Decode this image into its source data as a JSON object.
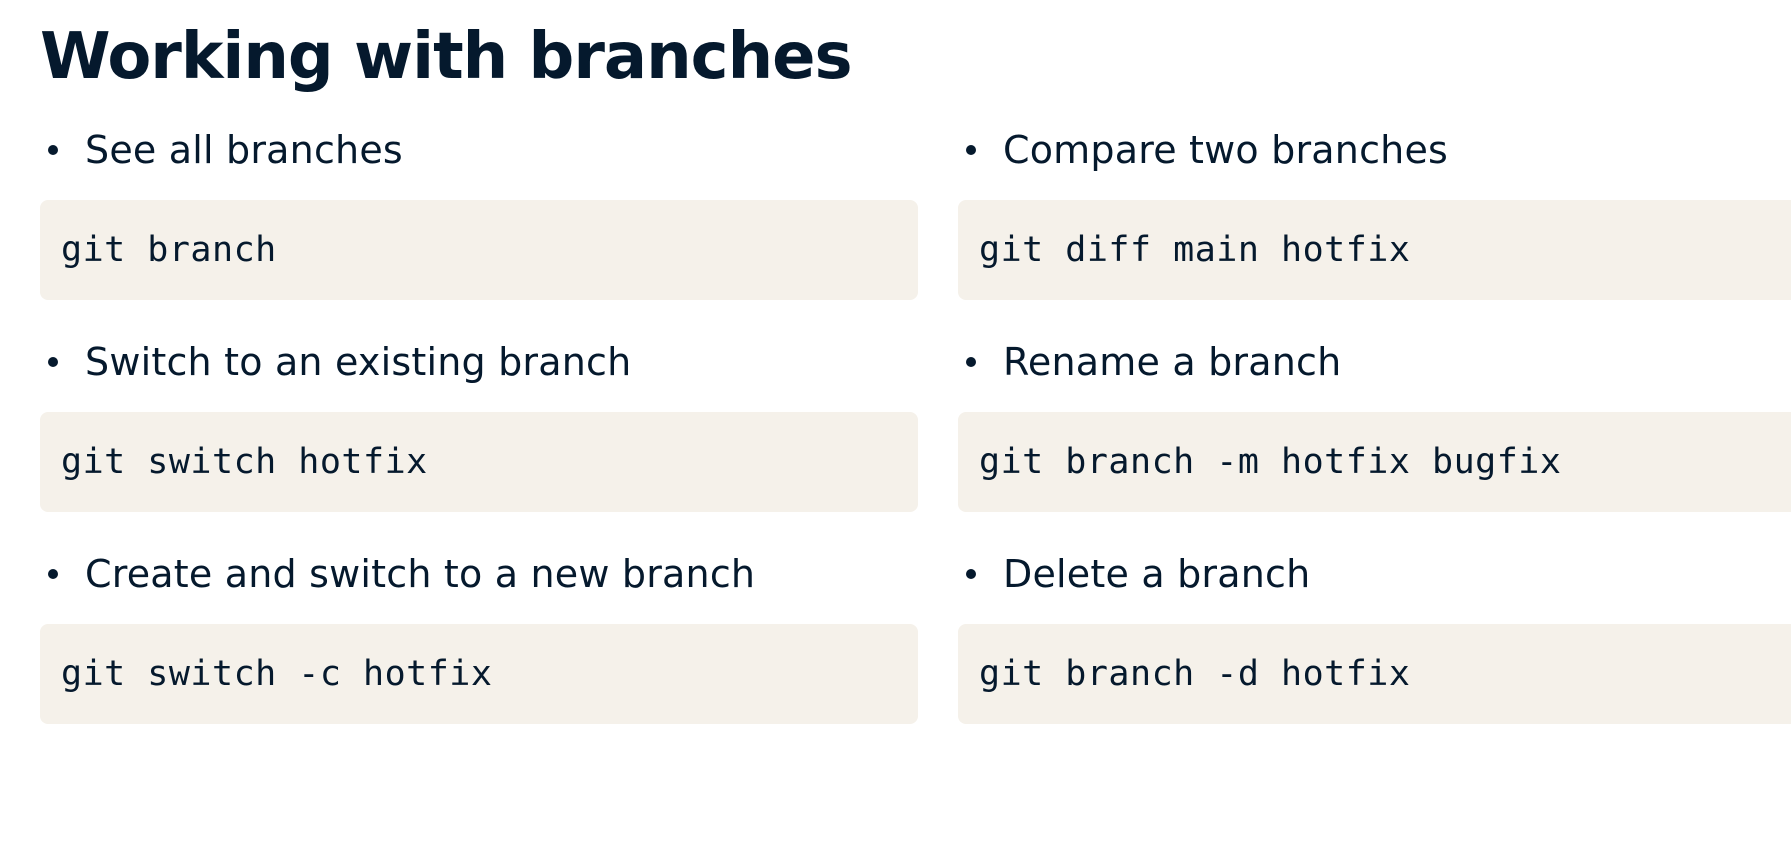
{
  "title": "Working with branches",
  "left_column": [
    {
      "bullet": "See all branches",
      "code": "git branch"
    },
    {
      "bullet": "Switch to an existing branch",
      "code": "git switch hotfix"
    },
    {
      "bullet": "Create and switch to a new branch",
      "code": "git switch -c hotfix"
    }
  ],
  "right_column": [
    {
      "bullet": "Compare two branches",
      "code": "git diff main hotfix"
    },
    {
      "bullet": "Rename a branch",
      "code": "git branch -m hotfix bugfix"
    },
    {
      "bullet": "Delete a branch",
      "code": "git branch -d hotfix"
    }
  ],
  "colors": {
    "text": "#05192d",
    "code_background": "#f5f1ea",
    "page_background": "#ffffff"
  }
}
